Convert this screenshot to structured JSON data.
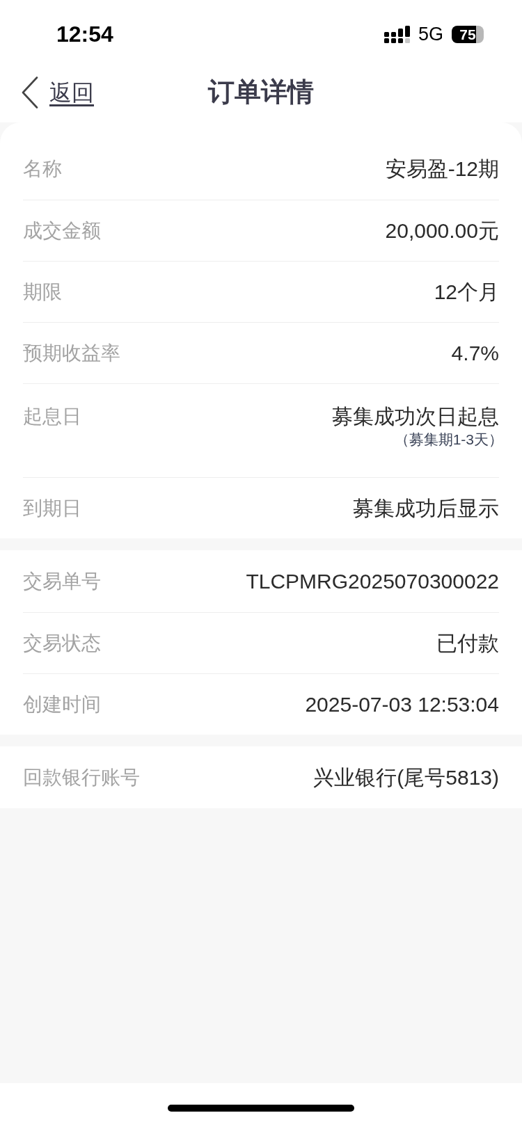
{
  "status_bar": {
    "time": "12:54",
    "network": "5G",
    "battery": "75"
  },
  "header": {
    "back": "返回",
    "title": "订单详情"
  },
  "sections": [
    {
      "rows": [
        {
          "label": "名称",
          "value": "安易盈-12期"
        },
        {
          "label": "成交金额",
          "value": "20,000.00元"
        },
        {
          "label": "期限",
          "value": "12个月"
        },
        {
          "label": "预期收益率",
          "value": "4.7%"
        },
        {
          "label": "起息日",
          "value": "募集成功次日起息",
          "note": "（募集期1-3天）"
        },
        {
          "label": "到期日",
          "value": "募集成功后显示"
        }
      ]
    },
    {
      "rows": [
        {
          "label": "交易单号",
          "value": "TLCPMRG2025070300022"
        },
        {
          "label": "交易状态",
          "value": "已付款"
        },
        {
          "label": "创建时间",
          "value": "2025-07-03 12:53:04"
        }
      ]
    },
    {
      "rows": [
        {
          "label": "回款银行账号",
          "value": "兴业银行(尾号5813)"
        }
      ]
    }
  ]
}
